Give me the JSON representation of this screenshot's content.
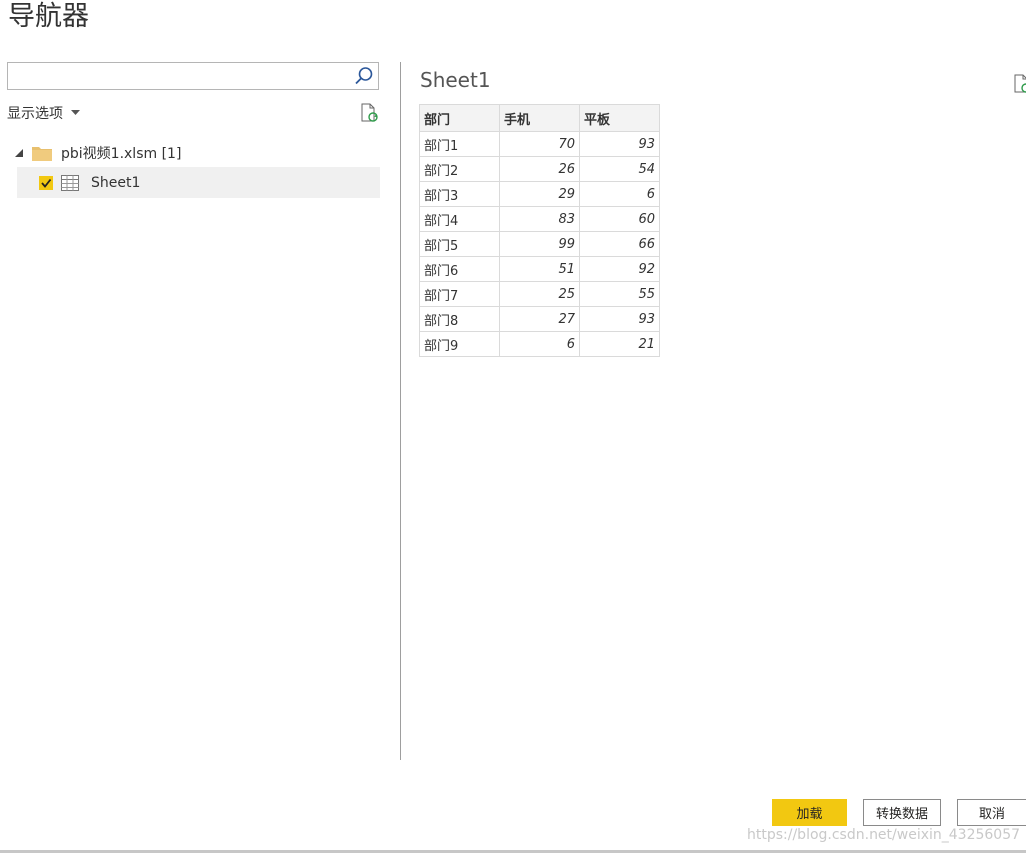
{
  "dialog": {
    "title": "导航器"
  },
  "left_pane": {
    "search": {
      "value": "",
      "placeholder": ""
    },
    "display_options_label": "显示选项",
    "tree": {
      "root_label": "pbi视频1.xlsm [1]",
      "items": [
        {
          "label": "Sheet1",
          "checked": true
        }
      ]
    }
  },
  "preview": {
    "title": "Sheet1",
    "columns": [
      "部门",
      "手机",
      "平板"
    ],
    "rows": [
      [
        "部门1",
        "70",
        "93"
      ],
      [
        "部门2",
        "26",
        "54"
      ],
      [
        "部门3",
        "29",
        "6"
      ],
      [
        "部门4",
        "83",
        "60"
      ],
      [
        "部门5",
        "99",
        "66"
      ],
      [
        "部门6",
        "51",
        "92"
      ],
      [
        "部门7",
        "25",
        "55"
      ],
      [
        "部门8",
        "27",
        "93"
      ],
      [
        "部门9",
        "6",
        "21"
      ]
    ]
  },
  "footer": {
    "load_label": "加载",
    "transform_label": "转换数据",
    "cancel_label": "取消",
    "watermark": "https://blog.csdn.net/weixin_43256057"
  },
  "colors": {
    "accent": "#f2c811",
    "selected_row": "#f0f0f0",
    "divider": "#9e9e9e"
  },
  "icons": {
    "search": "search-icon",
    "refresh": "refresh-icon",
    "folder": "folder-icon",
    "table": "table-icon",
    "expand": "collapse-triangle-icon",
    "dropdown": "caret-down-icon"
  }
}
